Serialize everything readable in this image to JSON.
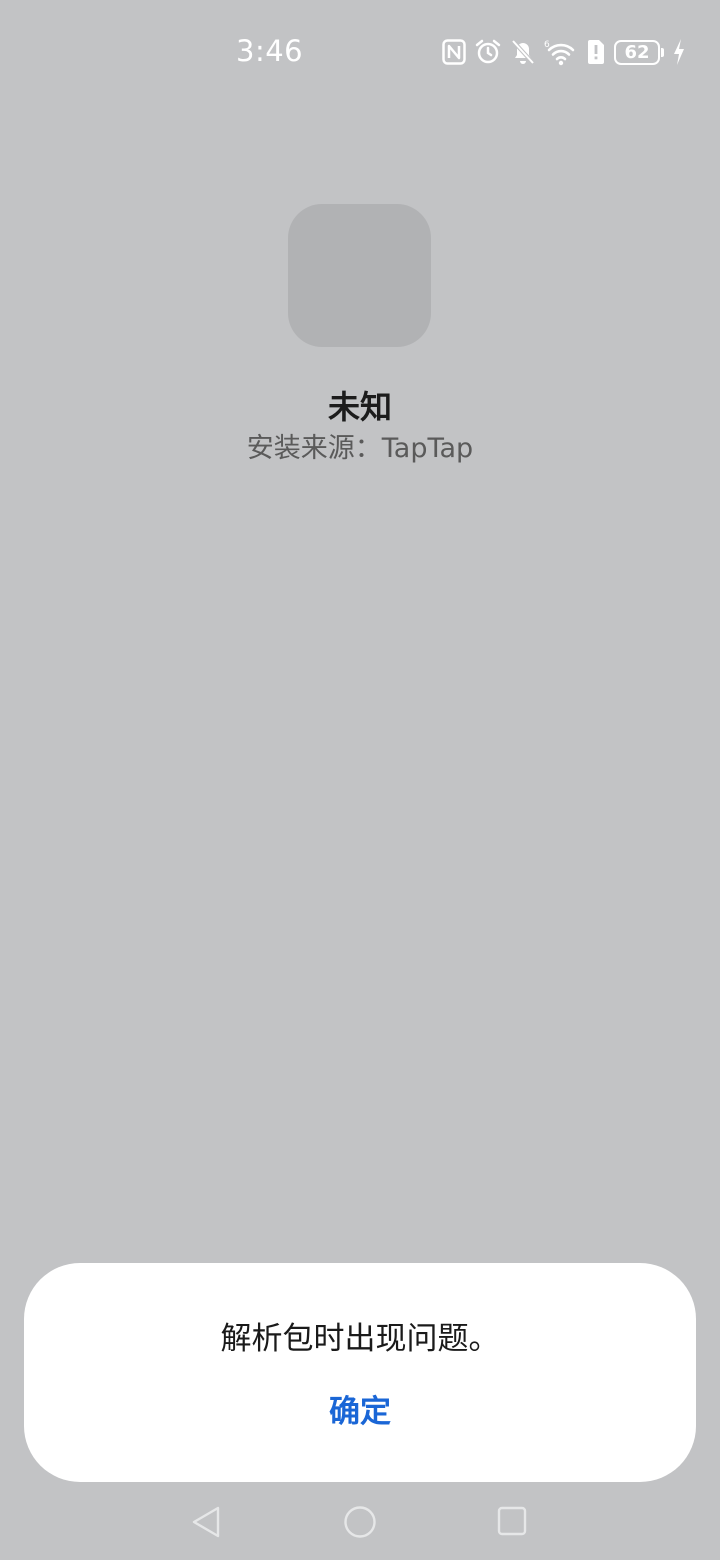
{
  "status_bar": {
    "time": "3:46",
    "icons": [
      "nfc-icon",
      "alarm-icon",
      "notifications-off-icon",
      "wifi-icon",
      "sim-alert-icon",
      "battery-icon",
      "charging-icon"
    ],
    "battery_level": "62",
    "icon_color": "#ffffff"
  },
  "app": {
    "name": "未知",
    "install_source": "安装来源：TapTap"
  },
  "dialog": {
    "message": "解析包时出现问题。",
    "confirm_label": "确定",
    "accent_color": "#1a66d6"
  },
  "nav_bar": {
    "buttons": [
      "back-icon",
      "home-icon",
      "recents-icon"
    ]
  }
}
